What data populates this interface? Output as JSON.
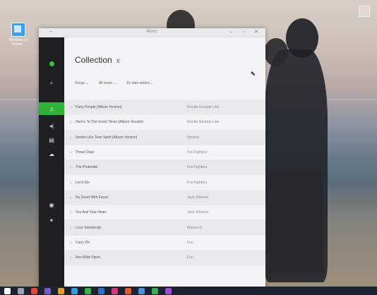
{
  "desktop": {
    "icon_label": "Windows 10 Insider..."
  },
  "window": {
    "title": "Music",
    "back_glyph": "←",
    "controls_glyph": "– ▫ ✕"
  },
  "sidebar": {
    "items": [
      {
        "icon": "music-logo-icon",
        "glyph": ""
      },
      {
        "icon": "search-icon",
        "glyph": "⌕"
      },
      {
        "icon": "music-note-icon",
        "glyph": "♫",
        "active": true
      },
      {
        "icon": "radio-icon",
        "glyph": "◂|"
      },
      {
        "icon": "now-playing-icon",
        "glyph": "▤"
      },
      {
        "icon": "cloud-icon",
        "glyph": "☁"
      },
      {
        "icon": "account-icon",
        "glyph": "◉"
      },
      {
        "icon": "settings-icon",
        "glyph": "✶"
      }
    ]
  },
  "collection": {
    "heading": "Collection",
    "heading_icon": "x",
    "filters": [
      "Songs",
      "All music",
      "By date added"
    ],
    "songs": [
      {
        "title": "Party People (Album Version)",
        "artist": "Florida Georgia Line"
      },
      {
        "title": "Here's To The Good Times (Album Version)",
        "artist": "Florida Georgia Line"
      },
      {
        "title": "Smells Like Teen Spirit (Album Version)",
        "artist": "Nirvana"
      },
      {
        "title": "These Days",
        "artist": "Foo Fighters"
      },
      {
        "title": "The Pretender",
        "artist": "Foo Fighters"
      },
      {
        "title": "Let It Die",
        "artist": "Foo Fighters"
      },
      {
        "title": "No Good With Faces",
        "artist": "Jack Johnson"
      },
      {
        "title": "You And Your Heart",
        "artist": "Jack Johnson"
      },
      {
        "title": "Love Somebody",
        "artist": "Maroon 5"
      },
      {
        "title": "Carry On",
        "artist": "Fun."
      },
      {
        "title": "Aim Wide Open",
        "artist": "Fun."
      }
    ]
  },
  "colors": {
    "accent": "#2fb13a",
    "sidebar_bg": "#1f1f21"
  }
}
